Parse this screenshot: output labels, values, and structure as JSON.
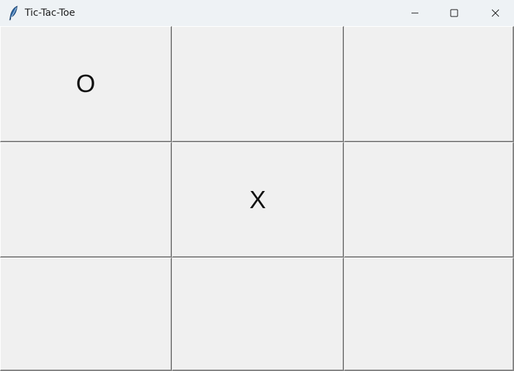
{
  "window": {
    "title": "Tic-Tac-Toe",
    "icon": "feather-icon",
    "controls": {
      "minimize": "minimize-icon",
      "maximize": "maximize-icon",
      "close": "close-icon"
    }
  },
  "board": {
    "cells": [
      [
        "O",
        "",
        ""
      ],
      [
        "",
        "X",
        ""
      ],
      [
        "",
        "",
        ""
      ]
    ]
  }
}
